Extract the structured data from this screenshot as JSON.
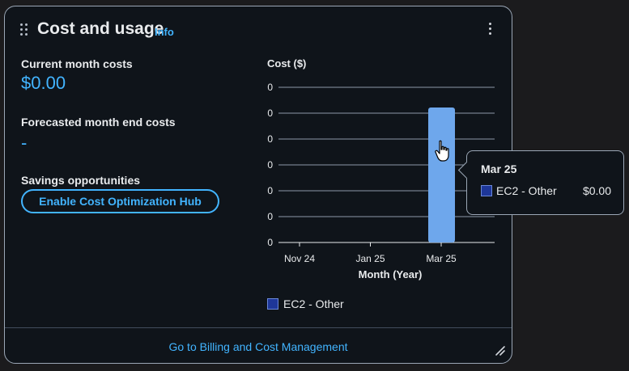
{
  "widget": {
    "title": "Cost and usage",
    "info_label": "Info",
    "current_month_label": "Current month costs",
    "current_month_value": "$0.00",
    "forecast_label": "Forecasted month end costs",
    "forecast_value": "-",
    "savings_label": "Savings opportunities",
    "savings_button": "Enable Cost Optimization Hub",
    "footer_link": "Go to Billing and Cost Management",
    "accent_color": "#42b4ff"
  },
  "chart_data": {
    "type": "bar",
    "title": "Cost ($)",
    "xlabel": "Month (Year)",
    "ylabel": "Cost ($)",
    "categories": [
      "Nov 24",
      "Jan 25",
      "Mar 25"
    ],
    "y_ticks": [
      "0",
      "0",
      "0",
      "0",
      "0",
      "0",
      "0"
    ],
    "series": [
      {
        "name": "EC2 - Other",
        "values": [
          0,
          0,
          0
        ],
        "color": "#1e3799"
      }
    ],
    "highlighted_category": "Mar 25",
    "grid": true,
    "legend": "bottom-left"
  },
  "tooltip": {
    "date": "Mar 25",
    "series_name": "EC2 - Other",
    "amount": "$0.00"
  }
}
